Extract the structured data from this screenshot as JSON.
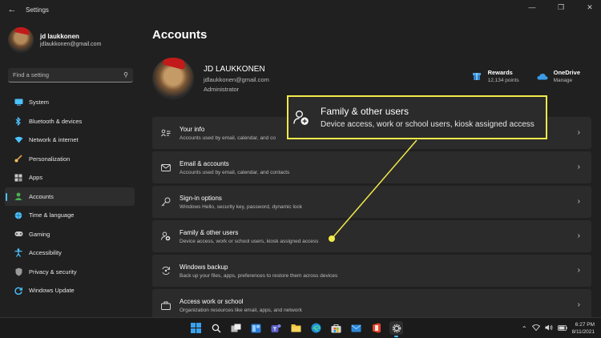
{
  "window": {
    "title": "Settings",
    "back_icon": "back-arrow-icon"
  },
  "sidebar": {
    "user": {
      "name": "jd laukkonen",
      "email": "jdlaukkonen@gmail.com"
    },
    "search": {
      "placeholder": "Find a setting",
      "icon": "search-icon"
    },
    "items": [
      {
        "label": "System",
        "icon": "system-icon",
        "color": "#4cc2ff"
      },
      {
        "label": "Bluetooth & devices",
        "icon": "bluetooth-icon",
        "color": "#4cc2ff"
      },
      {
        "label": "Network & internet",
        "icon": "wifi-icon",
        "color": "#4cc2ff"
      },
      {
        "label": "Personalization",
        "icon": "brush-icon",
        "color": "#f0a050"
      },
      {
        "label": "Apps",
        "icon": "apps-icon",
        "color": "#c8c8c8"
      },
      {
        "label": "Accounts",
        "icon": "accounts-icon",
        "color": "#4caf50",
        "active": true
      },
      {
        "label": "Time & language",
        "icon": "globe-icon",
        "color": "#4cc2ff"
      },
      {
        "label": "Gaming",
        "icon": "gamepad-icon",
        "color": "#c8c8c8"
      },
      {
        "label": "Accessibility",
        "icon": "accessibility-icon",
        "color": "#4cc2ff"
      },
      {
        "label": "Privacy & security",
        "icon": "shield-icon",
        "color": "#9a9a9a"
      },
      {
        "label": "Windows Update",
        "icon": "update-icon",
        "color": "#4cc2ff"
      }
    ]
  },
  "main": {
    "title": "Accounts",
    "user": {
      "name": "JD LAUKKONEN",
      "email": "jdlaukkonen@gmail.com",
      "role": "Administrator"
    },
    "badges": [
      {
        "title": "Rewards",
        "sub": "12,134 points",
        "icon": "rewards-icon"
      },
      {
        "title": "OneDrive",
        "sub": "Manage",
        "icon": "cloud-icon"
      }
    ],
    "rows": [
      {
        "title": "Your info",
        "desc": "Accounts used by email, calendar, and co",
        "icon": "your-info-icon"
      },
      {
        "title": "Email & accounts",
        "desc": "Accounts used by email, calendar, and contacts",
        "icon": "email-icon"
      },
      {
        "title": "Sign-in options",
        "desc": "Windows Hello, security key, password, dynamic lock",
        "icon": "key-icon"
      },
      {
        "title": "Family & other users",
        "desc": "Device access, work or school users, kiosk assigned access",
        "icon": "family-icon"
      },
      {
        "title": "Windows backup",
        "desc": "Back up your files, apps, preferences to restore them across devices",
        "icon": "backup-icon"
      },
      {
        "title": "Access work or school",
        "desc": "Organization resources like email, apps, and network",
        "icon": "briefcase-icon"
      }
    ]
  },
  "callout": {
    "title": "Family & other users",
    "desc": "Device access, work or school users, kiosk assigned access",
    "icon": "family-icon",
    "color": "#f2ea4b"
  },
  "taskbar": {
    "apps": [
      "windows-start-icon",
      "search-icon",
      "task-view-icon",
      "widgets-icon",
      "teams-icon",
      "file-explorer-icon",
      "edge-icon",
      "store-icon",
      "mail-icon",
      "office-icon",
      "settings-icon"
    ],
    "time": "6:27 PM",
    "date": "8/11/2021"
  }
}
